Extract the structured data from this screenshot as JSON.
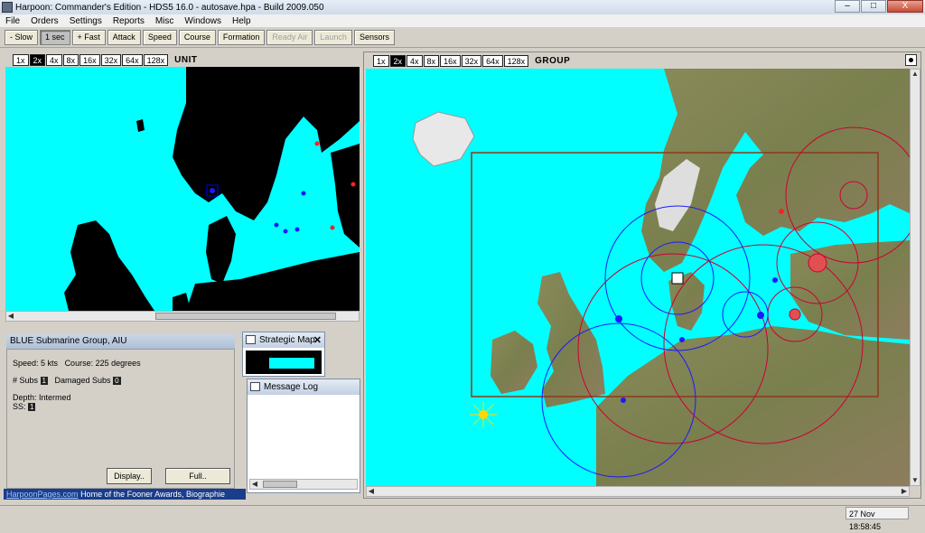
{
  "window": {
    "title": "Harpoon: Commander's Edition - HDS5 16.0 - autosave.hpa - Build 2009.050",
    "minimize": "–",
    "maximize": "□",
    "close": "X"
  },
  "menu": [
    "File",
    "Orders",
    "Settings",
    "Reports",
    "Misc",
    "Windows",
    "Help"
  ],
  "toolbar": {
    "slow": "- Slow",
    "one_sec": "1 sec",
    "fast": "+ Fast",
    "attack": "Attack",
    "speed": "Speed",
    "course": "Course",
    "formation": "Formation",
    "ready_air": "Ready Air",
    "launch": "Launch",
    "sensors": "Sensors"
  },
  "zoom_levels": [
    "1x",
    "2x",
    "4x",
    "8x",
    "16x",
    "32x",
    "64x",
    "128x"
  ],
  "unit_map": {
    "label": "UNIT",
    "selected_zoom": "2x"
  },
  "group_map": {
    "label": "GROUP",
    "selected_zoom": "2x"
  },
  "info_panel": {
    "title": "BLUE Submarine Group, AIU",
    "speed": "Speed: 5 kts",
    "course": "Course: 225 degrees",
    "subs_label": "# Subs",
    "subs_value": "1",
    "damaged_label": "Damaged Subs",
    "damaged_value": "0",
    "depth": "Depth: Intermed",
    "ss_label": "SS:",
    "ss_value": "1",
    "display_button": "Display..",
    "full_button": "Full.."
  },
  "strategic_map": {
    "title": "Strategic Map"
  },
  "message_log": {
    "title": "Message Log"
  },
  "bottom_link": {
    "link": "HarpoonPages.com",
    "text": "Home of the Fooner Awards, Biographie"
  },
  "status": {
    "clock": "27 Nov 18:58:45"
  },
  "colors": {
    "sea": "#00ffff",
    "land_unit_map": "#000000",
    "circle": "#cc0033",
    "blue_unit": "#1a1aff",
    "box": "#8b3a1a"
  }
}
